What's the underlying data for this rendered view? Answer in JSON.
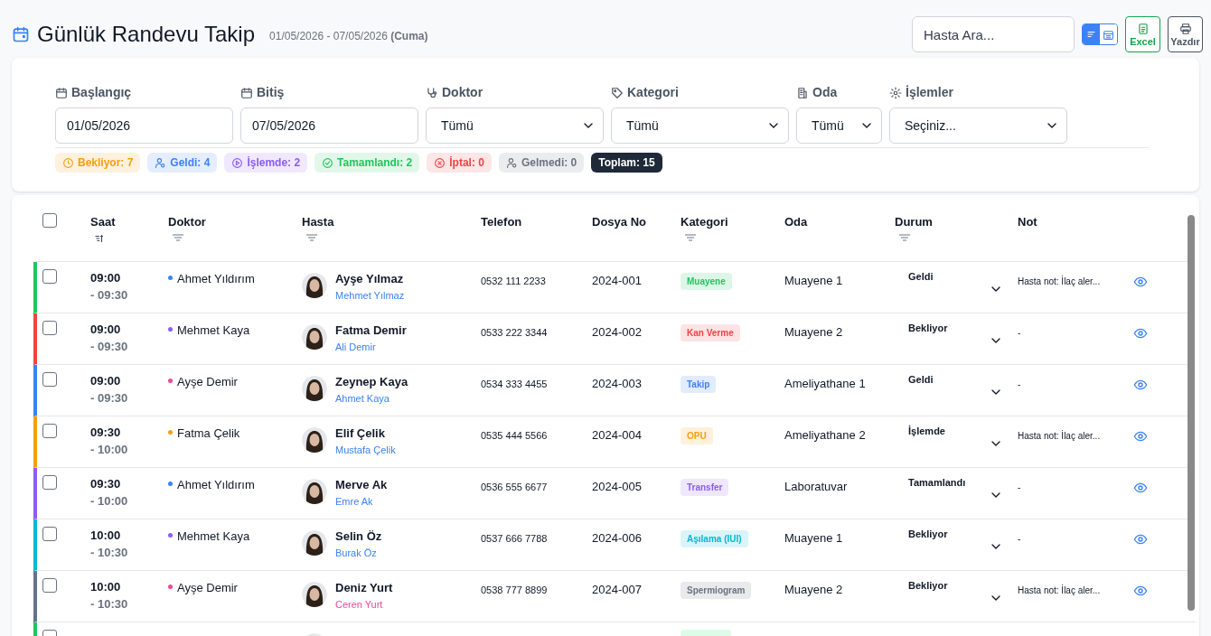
{
  "header": {
    "title": "Günlük Randevu Takip",
    "date_range": "01/05/2026 - 07/05/2026",
    "day": "(Cuma)",
    "search": {
      "placeholder": "Hasta Ara..."
    },
    "view_toggle": [
      {
        "kind": "list",
        "selected": true
      },
      {
        "kind": "calendar",
        "selected": false
      }
    ],
    "actions": [
      {
        "kind": "excel",
        "label": "Excel"
      },
      {
        "kind": "print",
        "label": "Yazdır"
      }
    ]
  },
  "filters": [
    {
      "kind": "date",
      "label": "Başlangıç",
      "value": "01/05/2026"
    },
    {
      "kind": "date",
      "label": "Bitiş",
      "value": "07/05/2026"
    },
    {
      "kind": "select",
      "label": "Doktor",
      "value": "Tümü"
    },
    {
      "kind": "select",
      "label": "Kategori",
      "value": "Tümü"
    },
    {
      "kind": "select-small",
      "label": "Oda",
      "value": "Tümü"
    },
    {
      "kind": "select",
      "label": "İşlemler",
      "value": "Seçiniz..."
    }
  ],
  "status_counts": [
    {
      "label": "Bekliyor: 7",
      "color": "#f59e0b"
    },
    {
      "label": "Geldi: 4",
      "color": "#3b82f6"
    },
    {
      "label": "İşlemde: 2",
      "color": "#8b5cf6"
    },
    {
      "label": "Tamamlandı: 2",
      "color": "#22c55e"
    },
    {
      "label": "İptal: 0",
      "color": "#ef4444"
    },
    {
      "label": "Gelmedi: 0",
      "color": "#6b7280"
    }
  ],
  "total": "Toplam: 15",
  "table": {
    "columns": [
      {
        "label": "Saat",
        "kind": "sort"
      },
      {
        "label": "Doktor",
        "kind": "filter"
      },
      {
        "label": "Hasta",
        "kind": "filter"
      },
      {
        "label": "Telefon",
        "kind": "plain"
      },
      {
        "label": "Dosya No",
        "kind": "plain"
      },
      {
        "label": "Kategori",
        "kind": "filter"
      },
      {
        "label": "Oda",
        "kind": "plain"
      },
      {
        "label": "Durum",
        "kind": "filter"
      },
      {
        "label": "Not",
        "kind": "plain"
      }
    ],
    "select_all": {
      "checked": false
    },
    "rows": [
      {
        "color": "#22c55e",
        "checked": false,
        "start": "09:00",
        "end": "- 09:30",
        "doctor": {
          "name": "Ahmet Yıldırım",
          "color": "#3b82f6"
        },
        "patient": "Ayşe Yılmaz",
        "relative": {
          "name": "Mehmet Yılmaz",
          "color": "#3b82f6"
        },
        "phone": "0532 111 2233",
        "file": "2024-001",
        "category": {
          "label": "Muayene",
          "color": "#22c55e"
        },
        "room": "Muayene 1",
        "status": "Geldi",
        "note": "Hasta not: İlaç aler..."
      },
      {
        "color": "#ef4444",
        "checked": false,
        "start": "09:00",
        "end": "- 09:30",
        "doctor": {
          "name": "Mehmet Kaya",
          "color": "#8b5cf6"
        },
        "patient": "Fatma Demir",
        "relative": {
          "name": "Ali Demir",
          "color": "#3b82f6"
        },
        "phone": "0533 222 3344",
        "file": "2024-002",
        "category": {
          "label": "Kan Verme",
          "color": "#ef4444"
        },
        "room": "Muayene 2",
        "status": "Bekliyor",
        "note": "-"
      },
      {
        "color": "#3b82f6",
        "checked": false,
        "start": "09:00",
        "end": "- 09:30",
        "doctor": {
          "name": "Ayşe Demir",
          "color": "#ec4899"
        },
        "patient": "Zeynep Kaya",
        "relative": {
          "name": "Ahmet Kaya",
          "color": "#3b82f6"
        },
        "phone": "0534 333 4455",
        "file": "2024-003",
        "category": {
          "label": "Takip",
          "color": "#3b82f6"
        },
        "room": "Ameliyathane 1",
        "status": "Geldi",
        "note": "-"
      },
      {
        "color": "#f59e0b",
        "checked": false,
        "start": "09:30",
        "end": "- 10:00",
        "doctor": {
          "name": "Fatma Çelik",
          "color": "#f59e0b"
        },
        "patient": "Elif Çelik",
        "relative": {
          "name": "Mustafa Çelik",
          "color": "#3b82f6"
        },
        "phone": "0535 444 5566",
        "file": "2024-004",
        "category": {
          "label": "OPU",
          "color": "#f59e0b"
        },
        "room": "Ameliyathane 2",
        "status": "İşlemde",
        "note": "Hasta not: İlaç aler..."
      },
      {
        "color": "#8b5cf6",
        "checked": false,
        "start": "09:30",
        "end": "- 10:00",
        "doctor": {
          "name": "Ahmet Yıldırım",
          "color": "#3b82f6"
        },
        "patient": "Merve Ak",
        "relative": {
          "name": "Emre Ak",
          "color": "#3b82f6"
        },
        "phone": "0536 555 6677",
        "file": "2024-005",
        "category": {
          "label": "Transfer",
          "color": "#8b5cf6"
        },
        "room": "Laboratuvar",
        "status": "Tamamlandı",
        "note": "-"
      },
      {
        "color": "#06b6d4",
        "checked": false,
        "start": "10:00",
        "end": "- 10:30",
        "doctor": {
          "name": "Mehmet Kaya",
          "color": "#8b5cf6"
        },
        "patient": "Selin Öz",
        "relative": {
          "name": "Burak Öz",
          "color": "#3b82f6"
        },
        "phone": "0537 666 7788",
        "file": "2024-006",
        "category": {
          "label": "Aşılama (IUI)",
          "color": "#06b6d4"
        },
        "room": "Muayene 1",
        "status": "Bekliyor",
        "note": "-"
      },
      {
        "color": "#64748b",
        "checked": false,
        "start": "10:00",
        "end": "- 10:30",
        "doctor": {
          "name": "Ayşe Demir",
          "color": "#ec4899"
        },
        "patient": "Deniz Yurt",
        "relative": {
          "name": "Ceren Yurt",
          "color": "#ec4899"
        },
        "phone": "0538 777 8899",
        "file": "2024-007",
        "category": {
          "label": "Spermiogram",
          "color": "#6b7280"
        },
        "room": "Muayene 2",
        "status": "Bekliyor",
        "note": "Hasta not: İlaç aler..."
      }
    ],
    "cut_row": {
      "color": "#22c55e",
      "checked": false,
      "category": {
        "color": "#dcfce7"
      }
    }
  }
}
